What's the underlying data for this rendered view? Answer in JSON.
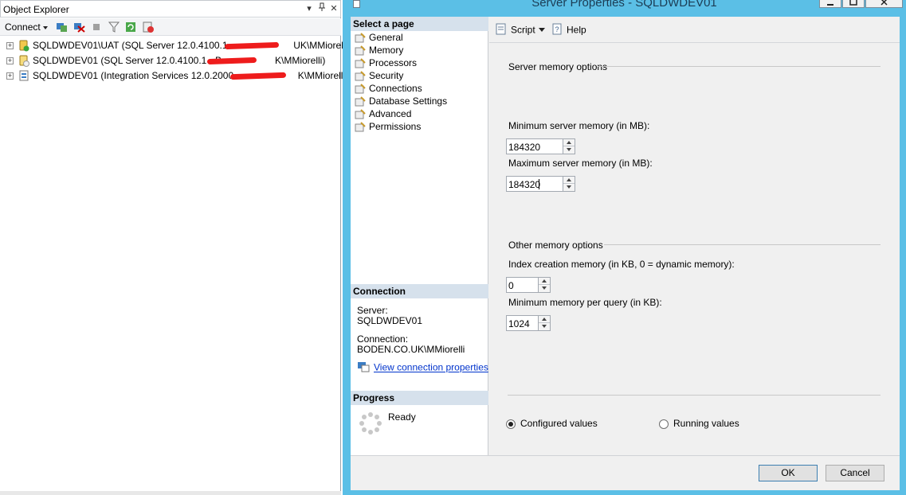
{
  "object_explorer": {
    "title": "Object Explorer",
    "title_controls": [
      "▾",
      "⊥",
      "✕"
    ],
    "connect_label": "Connect",
    "toolbar_icons": [
      "connect-object-explorer-icon",
      "disconnect-icon",
      "stop-icon",
      "filter-icon",
      "refresh-icon",
      "activity-monitor-icon"
    ],
    "tree": [
      {
        "name": "SQLDWDEV01\\UAT (SQL Server 12.0.4100.1 - ",
        "suffix": "UK\\MMiorelli)",
        "icon": "database-engine-running-icon"
      },
      {
        "name": "SQLDWDEV01 (SQL Server 12.0.4100.1 - B",
        "suffix": "K\\MMiorelli)",
        "icon": "database-engine-paused-icon"
      },
      {
        "name": "SQLDWDEV01 (Integration Services 12.0.2000 - ",
        "suffix": "K\\MMiorelli)",
        "icon": "integration-services-icon"
      }
    ]
  },
  "dialog": {
    "title": "Server Properties - SQLDWDEV01",
    "select_page_header": "Select a page",
    "pages": [
      "General",
      "Memory",
      "Processors",
      "Security",
      "Connections",
      "Database Settings",
      "Advanced",
      "Permissions"
    ],
    "connection_header": "Connection",
    "server_label": "Server:",
    "server_value": "SQLDWDEV01",
    "connection_label": "Connection:",
    "connection_value": "BODEN.CO.UK\\MMiorelli",
    "view_connection_properties": "View connection properties",
    "progress_header": "Progress",
    "progress_status": "Ready",
    "toolbar": {
      "script_label": "Script",
      "help_label": "Help"
    },
    "server_memory_options": "Server memory options",
    "min_server_memory_label": "Minimum server memory (in MB):",
    "min_server_memory_value": "184320",
    "max_server_memory_label": "Maximum server memory (in MB):",
    "max_server_memory_value": "184320",
    "other_memory_options": "Other memory options",
    "index_creation_memory_label": "Index creation memory (in KB, 0 = dynamic memory):",
    "index_creation_memory_value": "0",
    "min_memory_per_query_label": "Minimum memory per query (in KB):",
    "min_memory_per_query_value": "1024",
    "configured_values_label": "Configured values",
    "running_values_label": "Running values",
    "selected_values_mode": "configured",
    "ok_label": "OK",
    "cancel_label": "Cancel"
  },
  "colors": {
    "dialog_frame": "#5bbfe6",
    "section_header": "#d6e1ec",
    "link": "#0033cc",
    "redaction": "#ee1c1c"
  }
}
